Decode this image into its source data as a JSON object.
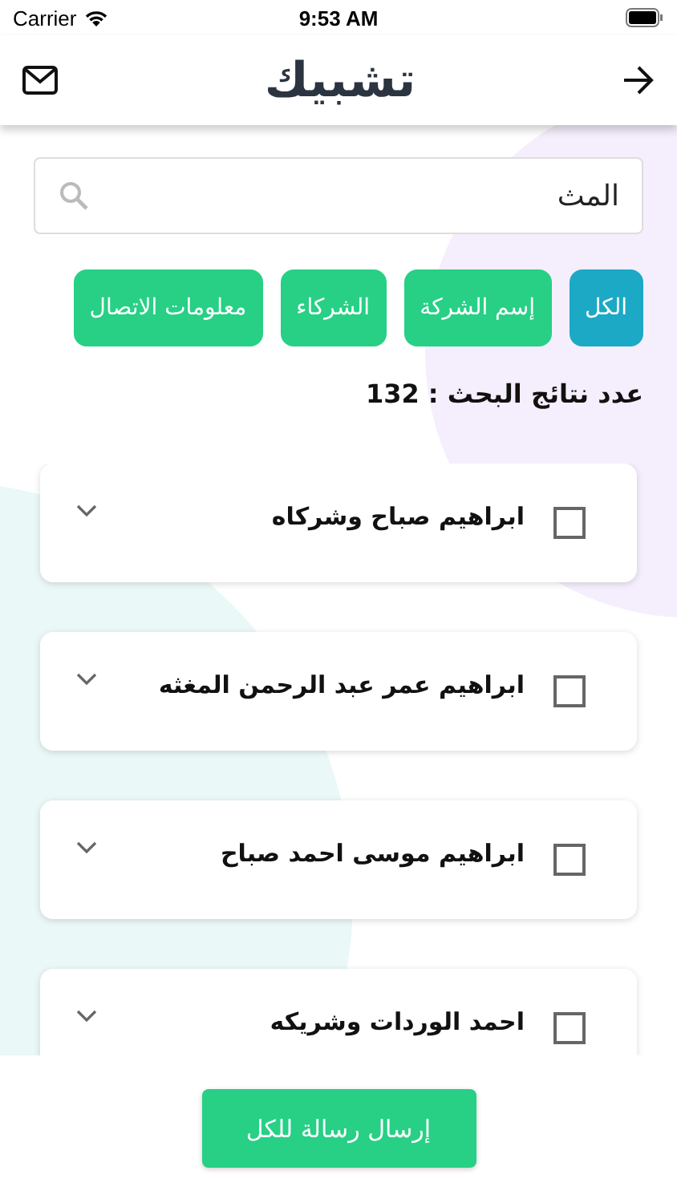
{
  "status_bar": {
    "carrier": "Carrier",
    "time": "9:53 AM"
  },
  "nav_bar": {
    "logo": "تشبيك"
  },
  "search": {
    "value": "المث"
  },
  "filters": [
    {
      "label": "الكل",
      "selected": true
    },
    {
      "label": "إسم الشركة",
      "selected": false
    },
    {
      "label": "الشركاء",
      "selected": false
    },
    {
      "label": "معلومات الاتصال",
      "selected": false
    }
  ],
  "result_count": "عدد نتائج البحث : 132",
  "results": [
    {
      "name": "ابراهيم صباح وشركاه",
      "checked": false,
      "expanded": false
    },
    {
      "name": "ابراهيم عمر عبد الرحمن المغثه",
      "checked": false,
      "expanded": false
    },
    {
      "name": "ابراهيم موسى احمد صباح",
      "checked": false,
      "expanded": false
    },
    {
      "name": "احمد الوردات وشريكه",
      "checked": false,
      "expanded": false
    }
  ],
  "send_all_button": "إرسال رسالة للكل"
}
